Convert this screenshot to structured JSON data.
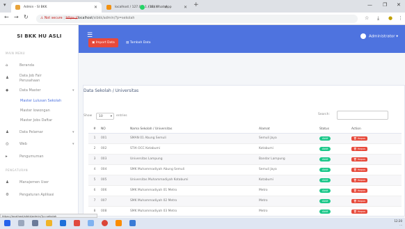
{
  "browser": {
    "tabs": [
      {
        "title": "Admin - SI BKK",
        "fav_color": "#e8a33a"
      },
      {
        "title": "localhost / 127.0.0.1 / bkk / ...",
        "fav_color": "#f29111"
      },
      {
        "title": "(15) WhatsApp",
        "fav_color": "#25d366"
      }
    ],
    "new_tab": "+",
    "address": {
      "security": "Not secure",
      "protocol": "https://",
      "host": "localhost",
      "path": "/sibkk/admin/?p=sekolah"
    }
  },
  "sidebar": {
    "brand": "SI BKK HU ASLI",
    "section_main": "MAIN MENU",
    "items": [
      {
        "label": "Beranda",
        "icon": "home-icon"
      },
      {
        "label": "Data Job Fair Perusahaan",
        "icon": "users-icon"
      },
      {
        "label": "Data Master",
        "icon": "database-icon"
      },
      {
        "label": "Data Pelamar",
        "icon": "user-icon"
      },
      {
        "label": "Web",
        "icon": "globe-icon"
      },
      {
        "label": "Pengumuman",
        "icon": "megaphone-icon"
      },
      {
        "label": "Manajemen User",
        "icon": "users-icon"
      },
      {
        "label": "Pengaturan Aplikasi",
        "icon": "gear-icon"
      }
    ],
    "submenu": [
      "Master Lulusan Sekolah",
      "Master lowongan",
      "Master Jobs Daftar"
    ],
    "section_settings": "PENGATURAN"
  },
  "topbar": {
    "user": "Administrator"
  },
  "actions": {
    "import": "Import Data",
    "add": "Tambah Data"
  },
  "card": {
    "title": "Data Sekolah / Universitas",
    "show_label": "Show",
    "entries_value": "10",
    "entries_label": "entries",
    "search_label": "Search:"
  },
  "table": {
    "headers": [
      "#",
      "NO",
      "Nama Sekolah / Universitas",
      "Alamat",
      "Status",
      "Action"
    ],
    "rows": [
      {
        "n": "1",
        "no": "001",
        "nama": "SMAN 01 Abung Semuli",
        "alamat": "Semuli Jaya",
        "status": "Aktif",
        "action": "Hapus"
      },
      {
        "n": "2",
        "no": "002",
        "nama": "STIA OCC Kotabumi",
        "alamat": "Kotabumi",
        "status": "Aktif",
        "action": "Hapus"
      },
      {
        "n": "3",
        "no": "003",
        "nama": "Universitas Lampung",
        "alamat": "Bandar Lampung",
        "status": "Aktif",
        "action": "Hapus"
      },
      {
        "n": "4",
        "no": "004",
        "nama": "SMK Muhammadiyah Abung Semuli",
        "alamat": "Semuli Jaya",
        "status": "Aktif",
        "action": "Hapus"
      },
      {
        "n": "5",
        "no": "005",
        "nama": "Universitas Muhammadiyah Kotabumi",
        "alamat": "Kotabumi",
        "status": "Aktif",
        "action": "Hapus"
      },
      {
        "n": "6",
        "no": "006",
        "nama": "SMK Muhammadiyah 01 Metro",
        "alamat": "Metro",
        "status": "Aktif",
        "action": "Hapus"
      },
      {
        "n": "7",
        "no": "007",
        "nama": "SMK Muhammadiyah 02 Metro",
        "alamat": "Metro",
        "status": "Aktif",
        "action": "Hapus"
      },
      {
        "n": "8",
        "no": "008",
        "nama": "SMK Muhammadiyah 03 Metro",
        "alamat": "Metro",
        "status": "Aktif",
        "action": "Hapus"
      }
    ]
  },
  "status_bar": "https://localhost/sibkk/admin/?p=sekolah",
  "tray": {
    "time": "12:20",
    "date": "..."
  },
  "colors": {
    "primary": "#4e73df",
    "danger": "#e74a3b",
    "success": "#1cc88a"
  }
}
